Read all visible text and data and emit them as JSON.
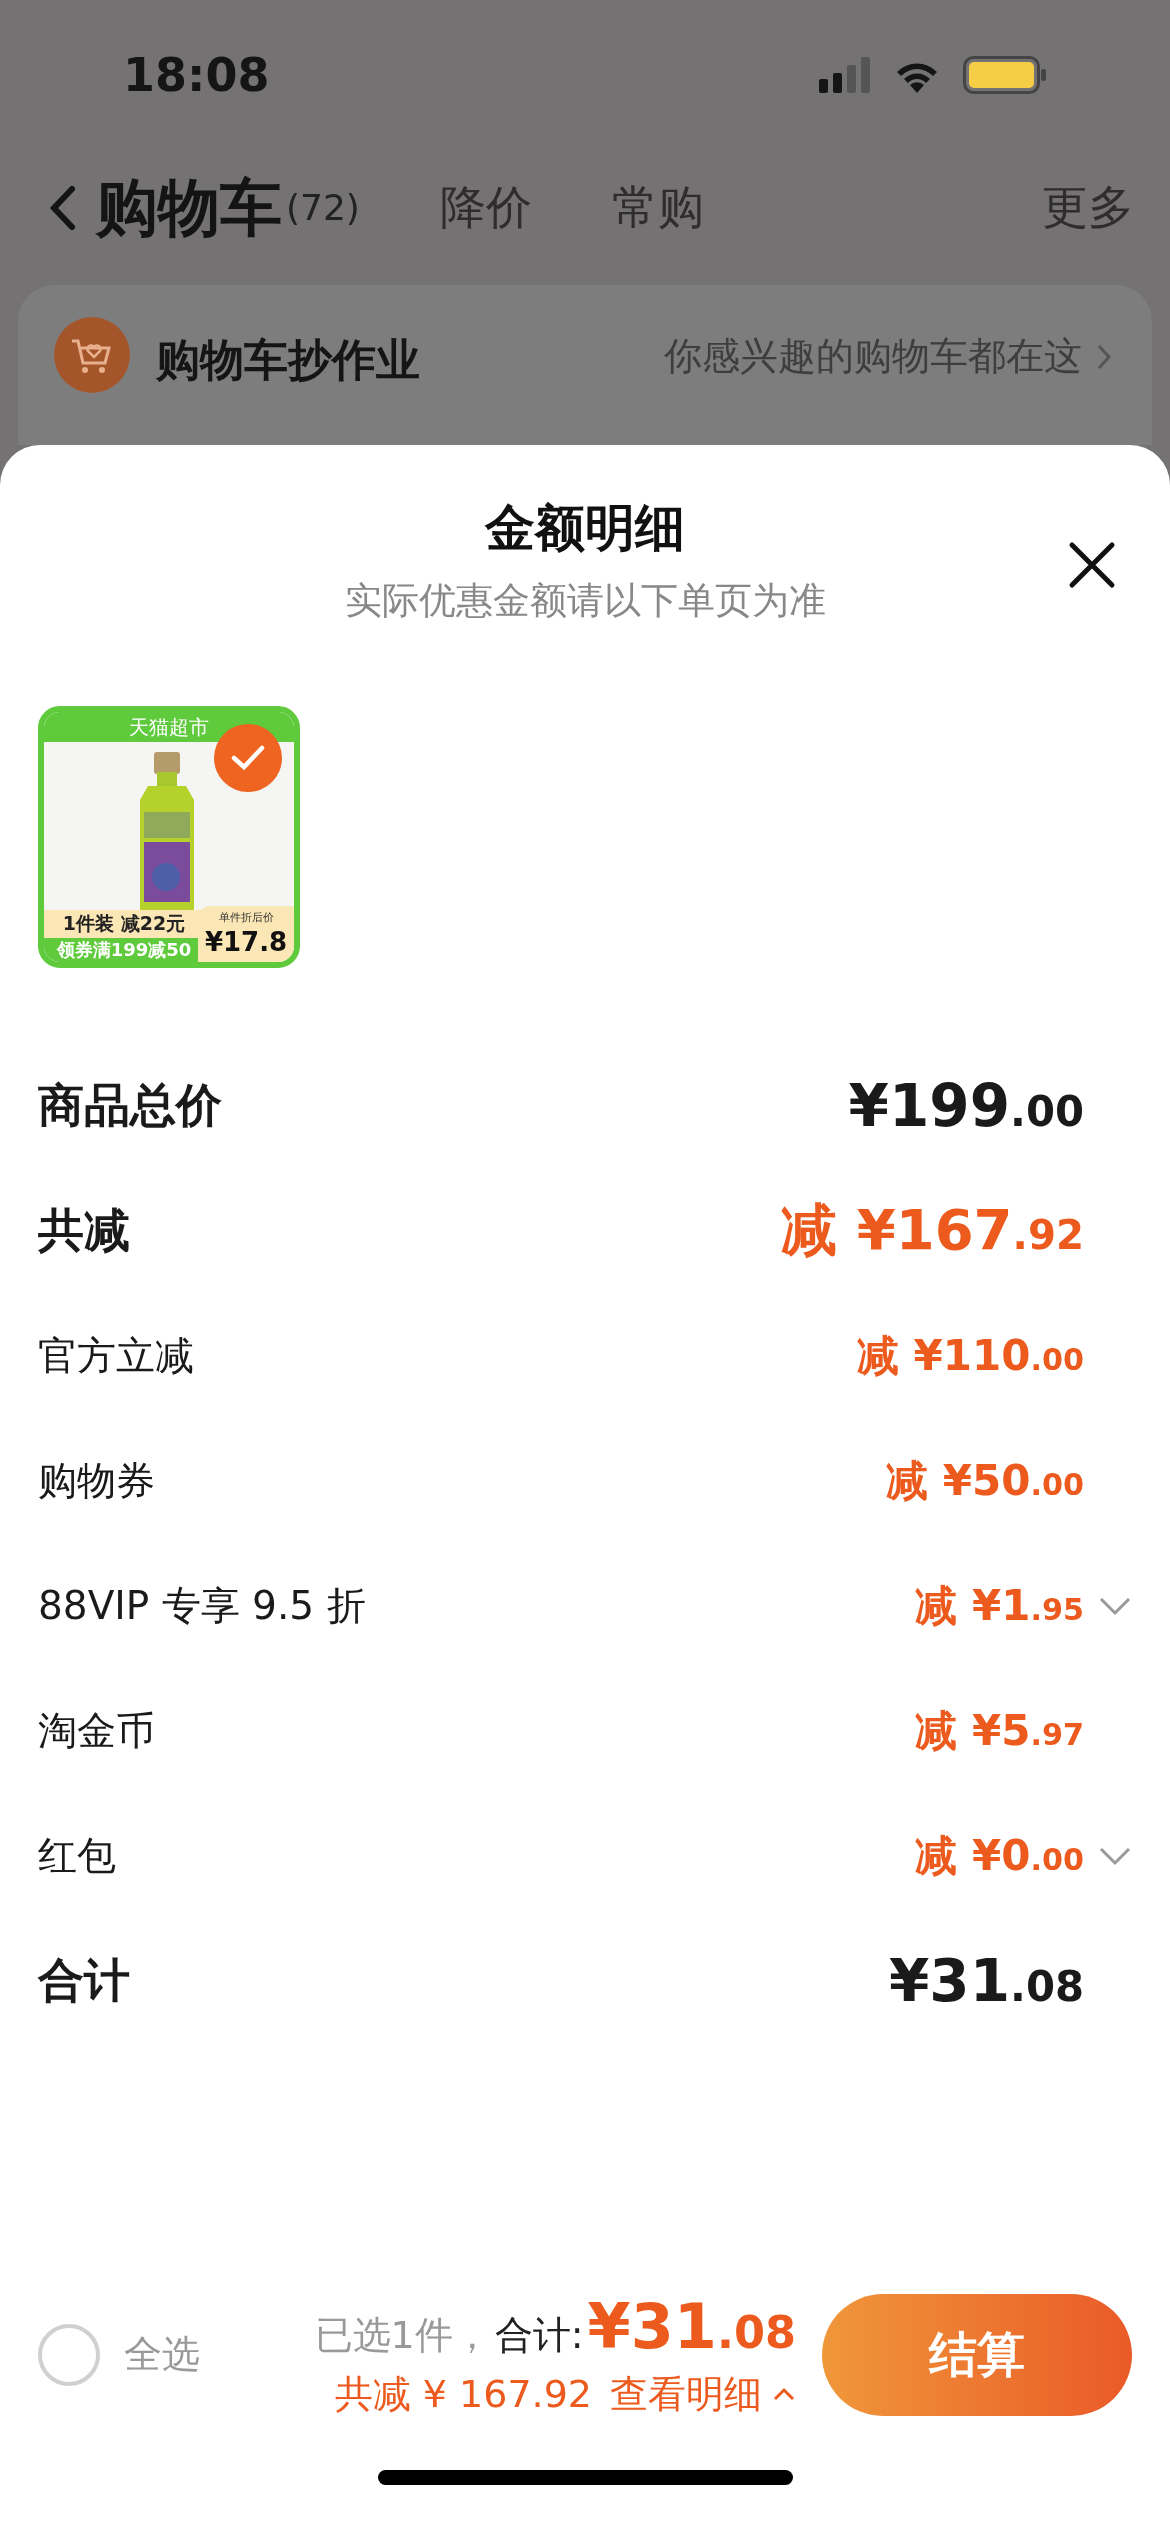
{
  "status_bar": {
    "time": "18:08"
  },
  "nav": {
    "title": "购物车",
    "count": "(72)",
    "tabs": [
      {
        "label": "降价",
        "selected": false
      },
      {
        "label": "常购",
        "selected": false
      }
    ],
    "more": "更多"
  },
  "banner": {
    "title": "购物车抄作业",
    "subtitle": "你感兴趣的购物车都在这"
  },
  "sheet": {
    "title": "金额明细",
    "subtitle": "实际优惠金额请以下单页为准",
    "product": {
      "store_tag": "天猫超市",
      "selected": true,
      "promo": "1件装 减22元",
      "coupon": "领券满199减50",
      "price_label": "单件折后价",
      "price": "¥17.8"
    },
    "rows": [
      {
        "label": "商品总价",
        "value": "¥199.00",
        "kind": "total",
        "expandable": false
      },
      {
        "label": "共减",
        "value": "减 ¥167.92",
        "kind": "discount-total",
        "expandable": false
      },
      {
        "label": "官方立减",
        "value": "减 ¥110.00",
        "kind": "discount",
        "expandable": false
      },
      {
        "label": "购物券",
        "value": "减 ¥50.00",
        "kind": "discount",
        "expandable": false
      },
      {
        "label": "88VIP 专享 9.5 折",
        "value": "减 ¥1.95",
        "kind": "discount",
        "expandable": true
      },
      {
        "label": "淘金币",
        "value": "减 ¥5.97",
        "kind": "discount",
        "expandable": false
      },
      {
        "label": "红包",
        "value": "减 ¥0.00",
        "kind": "discount",
        "expandable": true
      },
      {
        "label": "合计",
        "value": "¥31.08",
        "kind": "total",
        "expandable": false
      }
    ]
  },
  "footer": {
    "select_all": {
      "label": "全选",
      "checked": false
    },
    "selected_count": "已选1件，",
    "total_label": "合计:",
    "total": "¥31.08",
    "savings": "共减 ¥ 167.92",
    "details_link": "查看明细",
    "checkout": "结算"
  }
}
